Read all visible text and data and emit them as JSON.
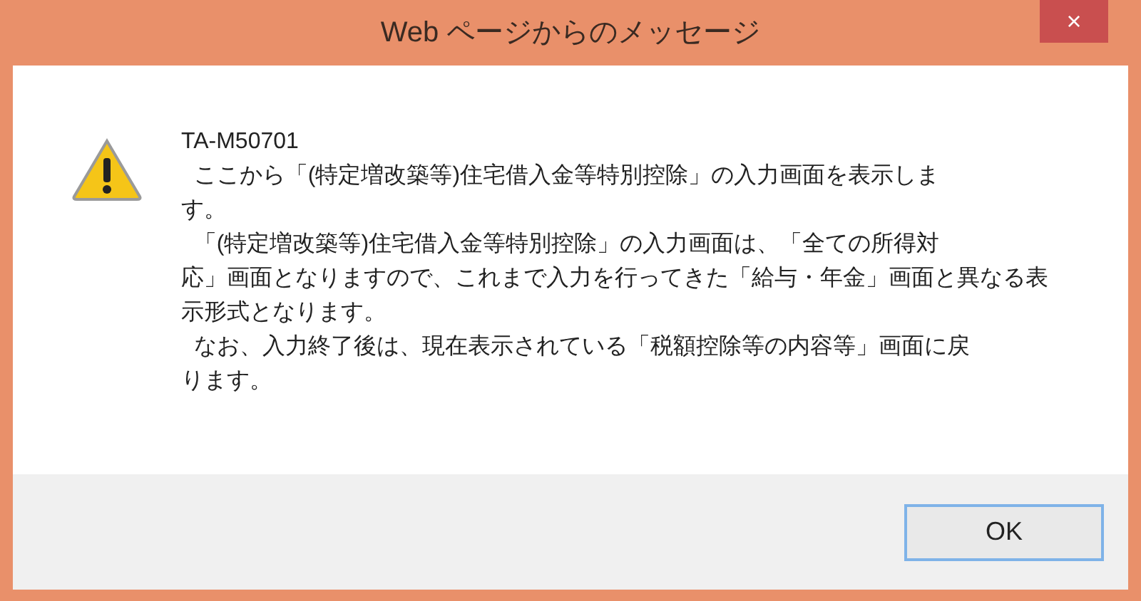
{
  "window": {
    "title": "Web ページからのメッセージ",
    "close": "×"
  },
  "message": {
    "code": "TA-M50701",
    "lines": [
      "  ここから「(特定増改築等)住宅借入金等特別控除」の入力画面を表示しま",
      "す。",
      "  「(特定増改築等)住宅借入金等特別控除」の入力画面は、「全ての所得対",
      "応」画面となりますので、これまで入力を行ってきた「給与・年金」画面と異なる表",
      "示形式となります。",
      "  なお、入力終了後は、現在表示されている「税額控除等の内容等」画面に戻",
      "ります。"
    ]
  },
  "buttons": [
    "OK"
  ]
}
